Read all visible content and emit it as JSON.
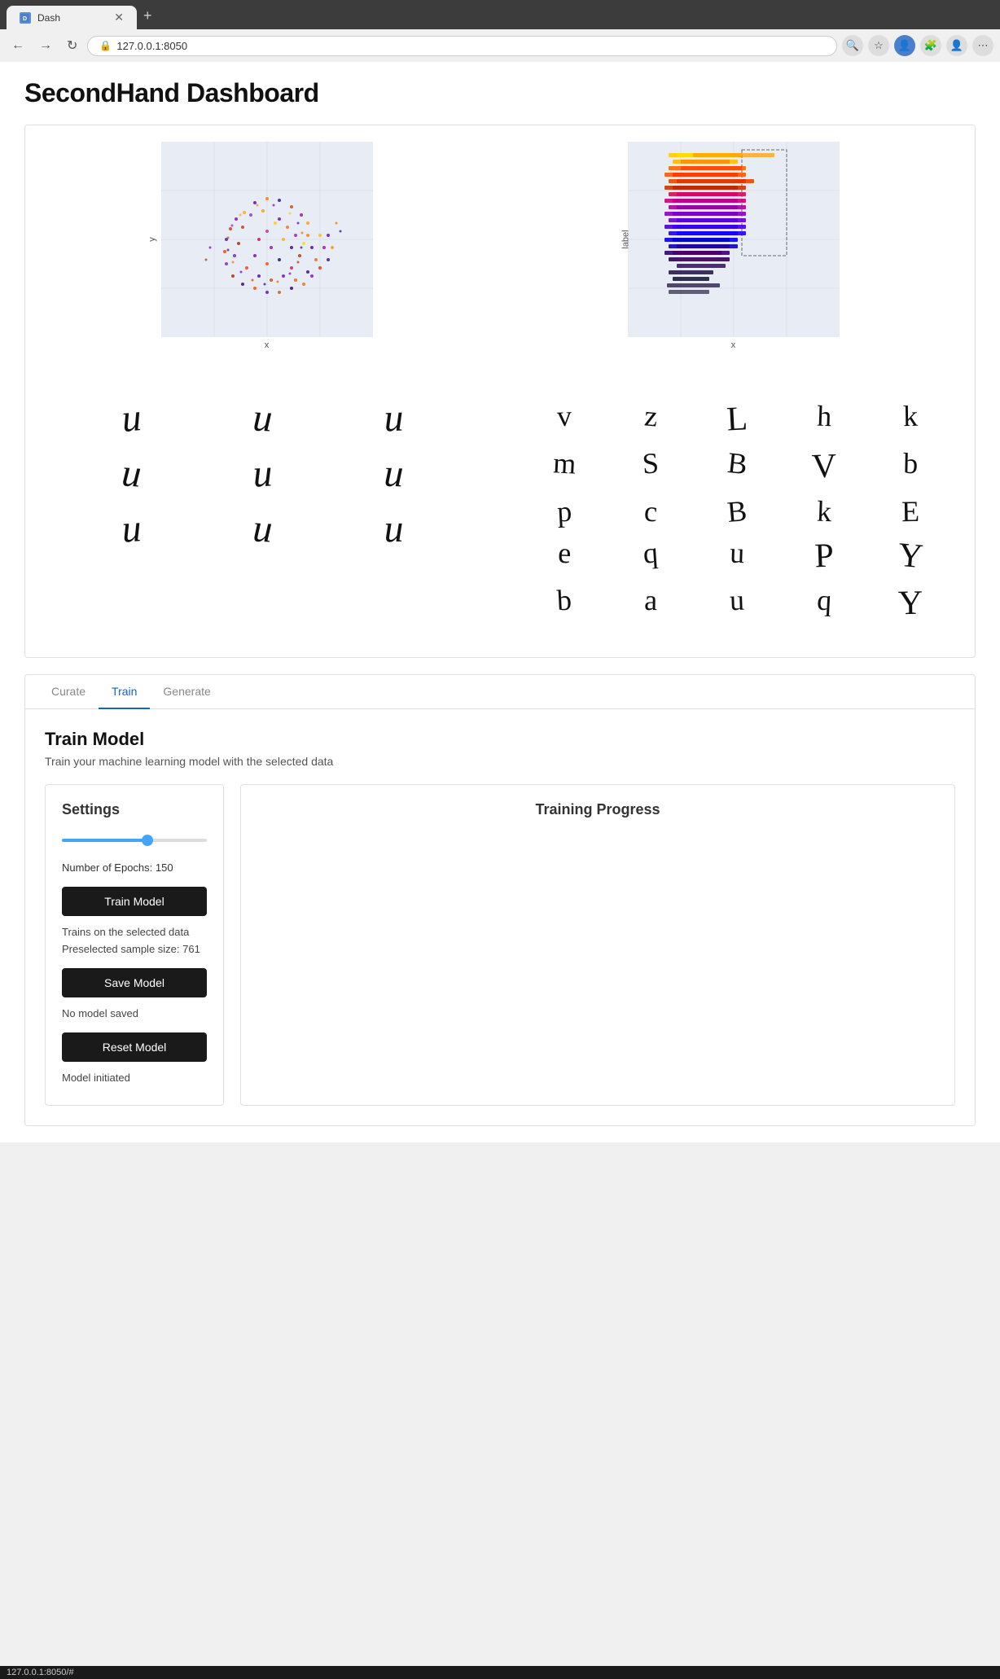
{
  "browser": {
    "tab_label": "Dash",
    "url": "127.0.0.1:8050",
    "new_tab_icon": "+",
    "back_disabled": false,
    "forward_disabled": true,
    "reload_icon": "↻"
  },
  "page": {
    "title": "SecondHand Dashboard"
  },
  "tabs": {
    "items": [
      {
        "label": "Curate",
        "id": "curate",
        "active": false
      },
      {
        "label": "Train",
        "id": "train",
        "active": true
      },
      {
        "label": "Generate",
        "id": "generate",
        "active": false
      }
    ]
  },
  "train_model": {
    "title": "Train Model",
    "subtitle": "Train your machine learning model with the selected data"
  },
  "settings": {
    "title": "Settings",
    "epochs_label": "Number of Epochs: 150",
    "slider_value": 60,
    "train_button": "Train Model",
    "trains_on_selected": "Trains on the selected data",
    "preselected_size": "Preselected sample size: 761",
    "save_button": "Save Model",
    "no_model_saved": "No model saved",
    "reset_button": "Reset Model",
    "model_initiated": "Model initiated"
  },
  "training_progress": {
    "title": "Training Progress"
  },
  "scatter_chart": {
    "y_label": "y",
    "x_label": "x"
  },
  "bar_chart": {
    "y_label": "label",
    "x_label": "x"
  },
  "handwriting": {
    "left_chars": [
      "u",
      "u",
      "u",
      "u",
      "u",
      "u",
      "u",
      "u",
      "u"
    ],
    "right_chars": [
      "v",
      "z",
      "L",
      "h",
      "k",
      "m",
      "S",
      "B",
      "V",
      "b",
      "p",
      "c",
      "B",
      "k",
      "E",
      "e",
      "q",
      "u",
      "P",
      "Y",
      "b",
      "a",
      "u",
      "q",
      "Y"
    ]
  },
  "status_bar": {
    "url": "127.0.0.1:8050/#"
  }
}
